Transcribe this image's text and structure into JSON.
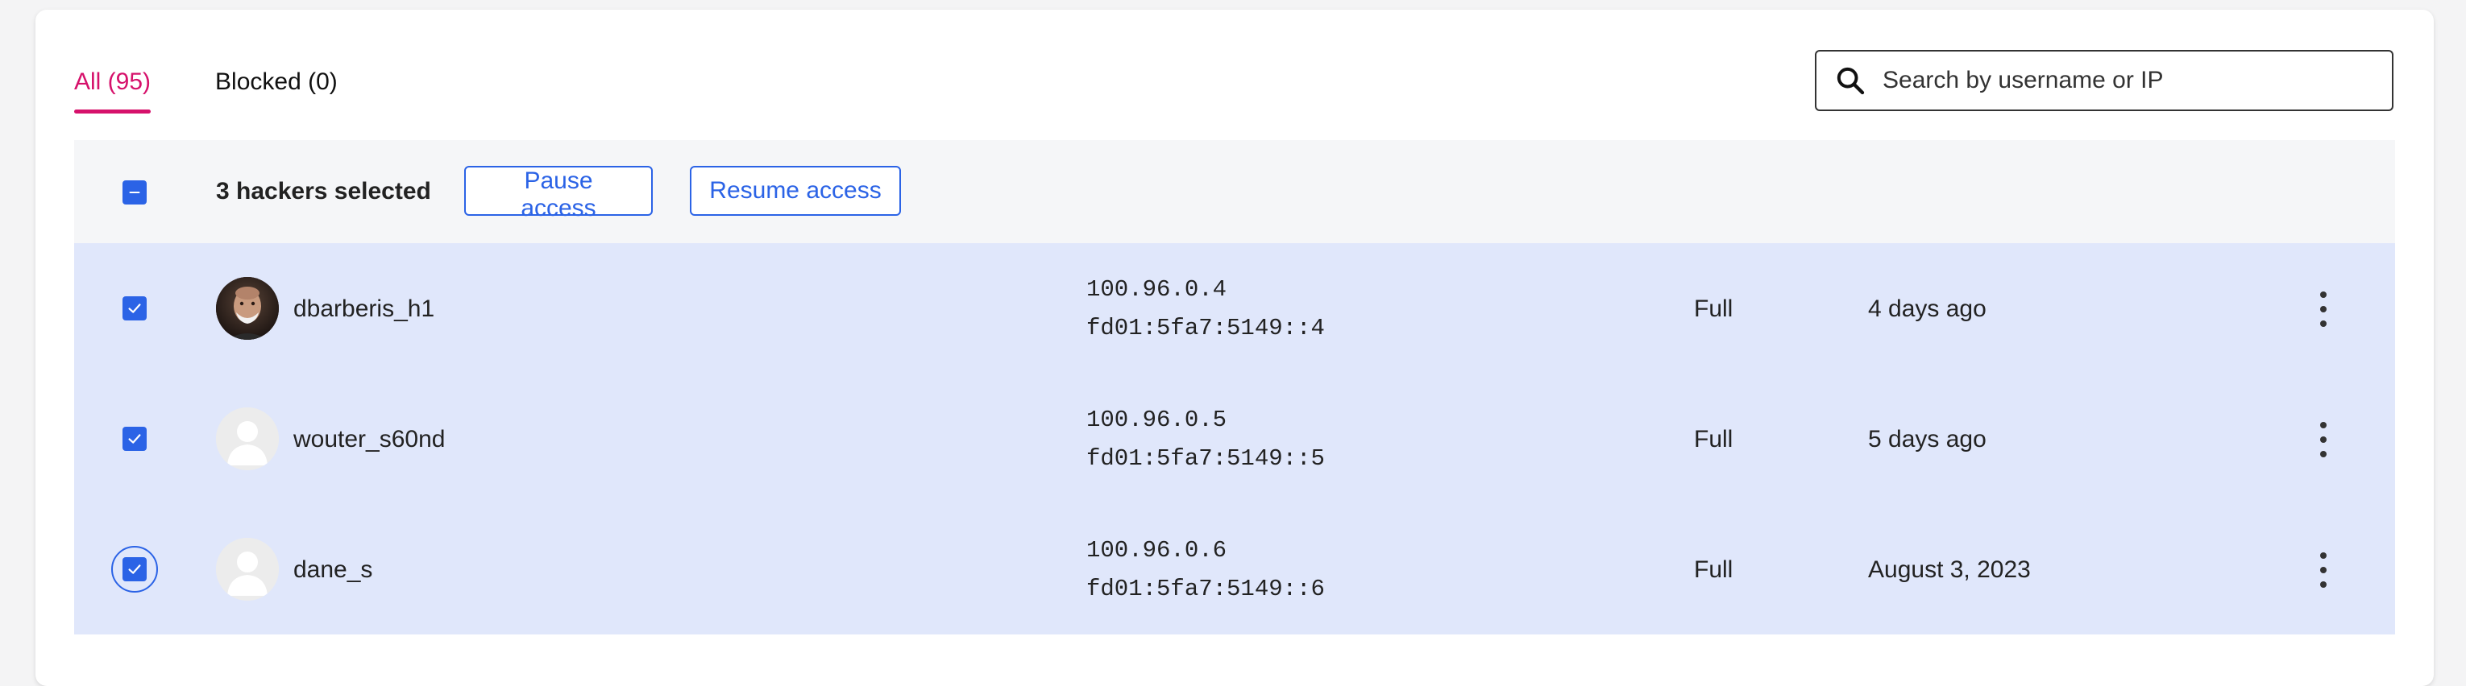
{
  "tabs": [
    {
      "label": "All (95)",
      "active": true
    },
    {
      "label": "Blocked (0)",
      "active": false
    }
  ],
  "search": {
    "placeholder": "Search by username or IP",
    "value": ""
  },
  "bulk": {
    "selected_text": "3 hackers selected",
    "pause_label": "Pause access",
    "resume_label": "Resume access"
  },
  "rows": [
    {
      "username": "dbarberis_h1",
      "ipv4": "100.96.0.4",
      "ipv6": "fd01:5fa7:5149::4",
      "access": "Full",
      "last_seen": "4 days ago",
      "avatar": "photo",
      "checked": true
    },
    {
      "username": "wouter_s60nd",
      "ipv4": "100.96.0.5",
      "ipv6": "fd01:5fa7:5149::5",
      "access": "Full",
      "last_seen": "5 days ago",
      "avatar": "default-avatar",
      "checked": true
    },
    {
      "username": "dane_s",
      "ipv4": "100.96.0.6",
      "ipv6": "fd01:5fa7:5149::6",
      "access": "Full",
      "last_seen": "August 3, 2023",
      "avatar": "default-avatar",
      "checked": true
    }
  ],
  "colors": {
    "accent": "#d6116b",
    "primary": "#2b63e6",
    "selected_row": "#e0e7fb",
    "bulk_bar": "#f5f6f8"
  },
  "icons": {
    "search": "search-icon",
    "row_menu": "kebab-menu-icon",
    "checkbox_indeterminate": "minus-icon",
    "checkbox_checked": "checkmark-icon"
  }
}
